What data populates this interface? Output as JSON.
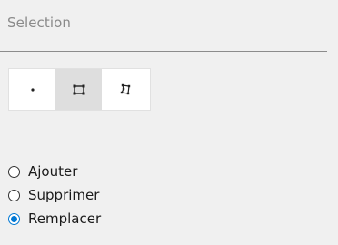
{
  "section": {
    "title": "Selection"
  },
  "toolbar": {
    "tools": [
      {
        "name": "point-select",
        "icon": "point-icon",
        "active": false
      },
      {
        "name": "rectangle-select",
        "icon": "rectangle-icon",
        "active": true
      },
      {
        "name": "polygon-select",
        "icon": "polygon-icon",
        "active": false
      }
    ]
  },
  "mode": {
    "options": [
      {
        "label": "Ajouter",
        "checked": false
      },
      {
        "label": "Supprimer",
        "checked": false
      },
      {
        "label": "Remplacer",
        "checked": true
      }
    ]
  },
  "colors": {
    "accent": "#0078d4",
    "active_tool_bg": "#dedede",
    "panel_bg": "#f0f0f0"
  }
}
